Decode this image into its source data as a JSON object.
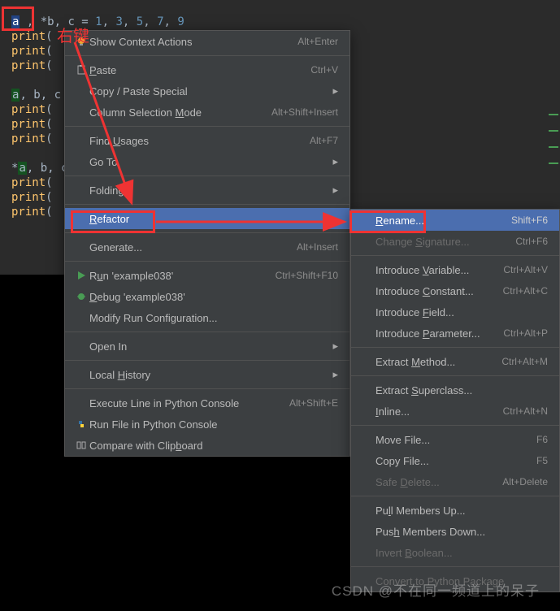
{
  "code": {
    "l1": {
      "a": "a",
      "rest": ", *b, c = ",
      "n1": "1",
      "n2": "3",
      "n3": "5",
      "n4": "7",
      "n5": "9"
    },
    "pr": "print",
    "l2": "(",
    "l5": {
      "a": "a",
      "rest": ", b, c"
    },
    "l9": {
      "star": "*",
      "a": "a",
      "rest": ", b, c"
    }
  },
  "annot": {
    "rclick": "右键"
  },
  "menu1": [
    {
      "icon": "bulb",
      "label": "Show Context Actions",
      "shortcut": "Alt+Enter"
    },
    {
      "sep": true
    },
    {
      "icon": "paste",
      "label": "Paste",
      "ul": "P",
      "shortcut": "Ctrl+V"
    },
    {
      "label": "Copy / Paste Special",
      "arrow": true
    },
    {
      "label": "Column Selection Mode",
      "ul": "M",
      "shortcut": "Alt+Shift+Insert"
    },
    {
      "sep": true
    },
    {
      "label": "Find Usages",
      "ul": "U",
      "shortcut": "Alt+F7"
    },
    {
      "label": "Go To",
      "arrow": true
    },
    {
      "sep": true
    },
    {
      "label": "Folding",
      "arrow": true
    },
    {
      "sep": true
    },
    {
      "label": "Refactor",
      "ul": "R",
      "arrow": true,
      "highlight": true
    },
    {
      "sep": true
    },
    {
      "label": "Generate...",
      "shortcut": "Alt+Insert"
    },
    {
      "sep": true
    },
    {
      "icon": "play",
      "label": "Run 'example038'",
      "ul": "u",
      "shortcut": "Ctrl+Shift+F10"
    },
    {
      "icon": "bug",
      "label": "Debug 'example038'",
      "ul": "D"
    },
    {
      "label": "Modify Run Configuration..."
    },
    {
      "sep": true
    },
    {
      "label": "Open In",
      "arrow": true
    },
    {
      "sep": true
    },
    {
      "label": "Local History",
      "ul": "H",
      "arrow": true
    },
    {
      "sep": true
    },
    {
      "label": "Execute Line in Python Console",
      "shortcut": "Alt+Shift+E"
    },
    {
      "icon": "py",
      "label": "Run File in Python Console"
    },
    {
      "icon": "diff",
      "label": "Compare with Clipboard",
      "ul": "b"
    }
  ],
  "menu2": [
    {
      "label": "Rename...",
      "ul": "R",
      "shortcut": "Shift+F6",
      "highlight": true
    },
    {
      "label": "Change Signature...",
      "ul": "S",
      "shortcut": "Ctrl+F6",
      "disabled": true
    },
    {
      "sep": true
    },
    {
      "label": "Introduce Variable...",
      "ul": "V",
      "shortcut": "Ctrl+Alt+V"
    },
    {
      "label": "Introduce Constant...",
      "ul": "C",
      "shortcut": "Ctrl+Alt+C"
    },
    {
      "label": "Introduce Field...",
      "ul": "F"
    },
    {
      "label": "Introduce Parameter...",
      "ul": "P",
      "shortcut": "Ctrl+Alt+P"
    },
    {
      "sep": true
    },
    {
      "label": "Extract Method...",
      "ul": "M",
      "shortcut": "Ctrl+Alt+M"
    },
    {
      "sep": true
    },
    {
      "label": "Extract Superclass...",
      "ul": "S"
    },
    {
      "label": "Inline...",
      "ul": "I",
      "shortcut": "Ctrl+Alt+N"
    },
    {
      "sep": true
    },
    {
      "label": "Move File...",
      "shortcut": "F6"
    },
    {
      "label": "Copy File...",
      "shortcut": "F5"
    },
    {
      "label": "Safe Delete...",
      "ul": "D",
      "shortcut": "Alt+Delete",
      "disabled": true
    },
    {
      "sep": true
    },
    {
      "label": "Pull Members Up...",
      "ul": "l"
    },
    {
      "label": "Push Members Down...",
      "ul": "h"
    },
    {
      "label": "Invert Boolean...",
      "ul": "B",
      "disabled": true
    },
    {
      "sep": true
    },
    {
      "label": "Convert to Python Package",
      "disabled": true
    }
  ],
  "watermark": "CSDN @不在同一频道上的呆子"
}
